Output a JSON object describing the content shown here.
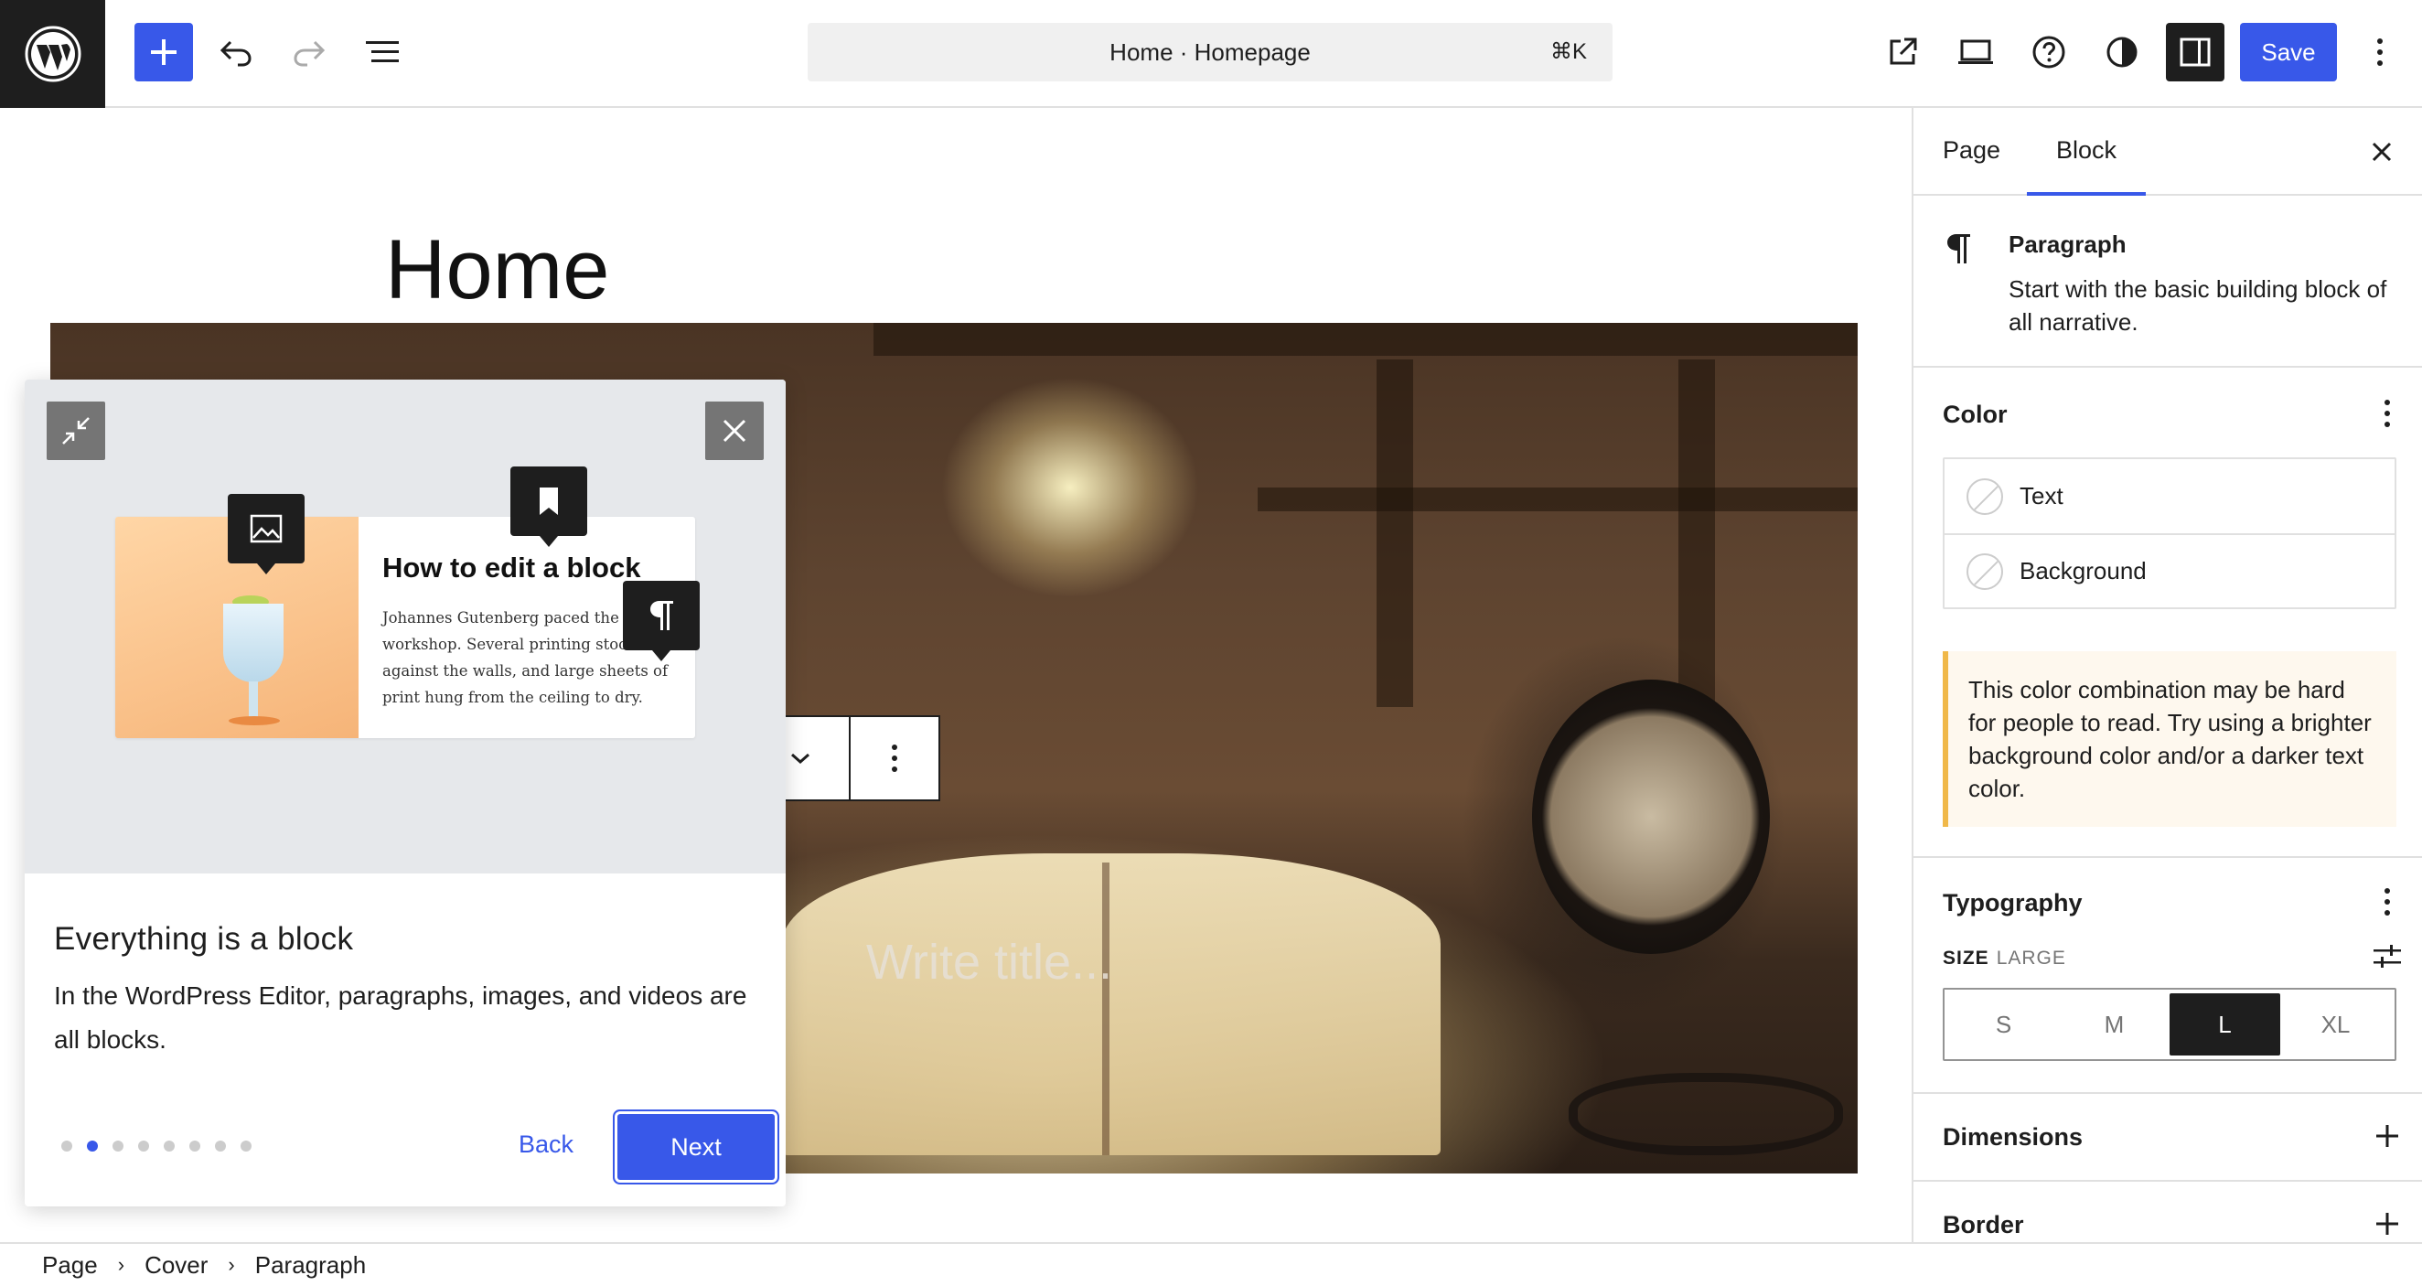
{
  "topbar": {
    "command_title": "Home · Homepage",
    "command_shortcut": "⌘K",
    "save_label": "Save"
  },
  "canvas": {
    "page_title": "Home",
    "cover_placeholder": "Write title..."
  },
  "guide": {
    "demo_heading": "How to edit a block",
    "demo_body": "Johannes Gutenberg paced the his workshop. Several printing stood against the walls, and large sheets of print hung from the ceiling to dry.",
    "title": "Everything is a block",
    "text": "In the WordPress Editor, paragraphs, images, and videos are all blocks.",
    "step_count": 8,
    "current_step": 2,
    "back_label": "Back",
    "next_label": "Next"
  },
  "breadcrumb": {
    "items": [
      "Page",
      "Cover",
      "Paragraph"
    ]
  },
  "sidebar": {
    "tabs": [
      {
        "label": "Page",
        "active": false
      },
      {
        "label": "Block",
        "active": true
      }
    ],
    "block": {
      "title": "Paragraph",
      "description": "Start with the basic building block of all narrative."
    },
    "color": {
      "heading": "Color",
      "items": [
        "Text",
        "Background"
      ],
      "warning": "This color combination may be hard for people to read. Try using a brighter background color and/or a darker text color."
    },
    "typography": {
      "heading": "Typography",
      "size_label": "SIZE",
      "size_value": "LARGE",
      "sizes": [
        "S",
        "M",
        "L",
        "XL"
      ],
      "active_size": "L"
    },
    "dimensions": {
      "heading": "Dimensions"
    },
    "border": {
      "heading": "Border"
    }
  },
  "colors": {
    "accent": "#3858e9",
    "dark": "#1e1e1e",
    "warning_border": "#f0b849",
    "warning_bg": "#fef8ee"
  }
}
